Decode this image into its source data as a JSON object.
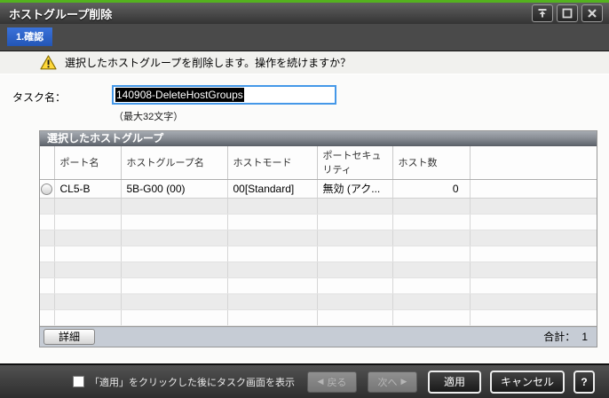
{
  "titlebar": {
    "title": "ホストグループ削除"
  },
  "step_badge": "1.確認",
  "warning_message": "選択したホストグループを削除します。操作を続けますか？",
  "task": {
    "label": "タスク名：",
    "value": "140908-DeleteHostGroups",
    "max_hint": "（最大32文字）"
  },
  "table": {
    "title": "選択したホストグループ",
    "columns": {
      "port": "ポート名",
      "group": "ホストグループ名",
      "mode": "ホストモード",
      "security": "ポートセキュリティ",
      "count": "ホスト数"
    },
    "row": {
      "port": "CL5-B",
      "group": "5B-G00 (00)",
      "mode": "00[Standard]",
      "security": "無効 (アク...",
      "count": "0"
    },
    "empty_row_count": 8,
    "detail_button": "詳細",
    "total_label": "合計：",
    "total_value": "1"
  },
  "bottom_bar": {
    "checkbox_label": "「適用」をクリックした後にタスク画面を表示",
    "checkbox_checked": false,
    "back_arrow": "◀",
    "back_label": "戻る",
    "next_label": "次へ",
    "next_arrow": "▶",
    "apply_label": "適用",
    "cancel_label": "キャンセル",
    "help_label": "?"
  },
  "colors": {
    "accent_green": "#54b21f",
    "step_blue": "#2c5fc4",
    "focus_blue": "#4598e8",
    "footer_gray": "#c6ccd5"
  }
}
